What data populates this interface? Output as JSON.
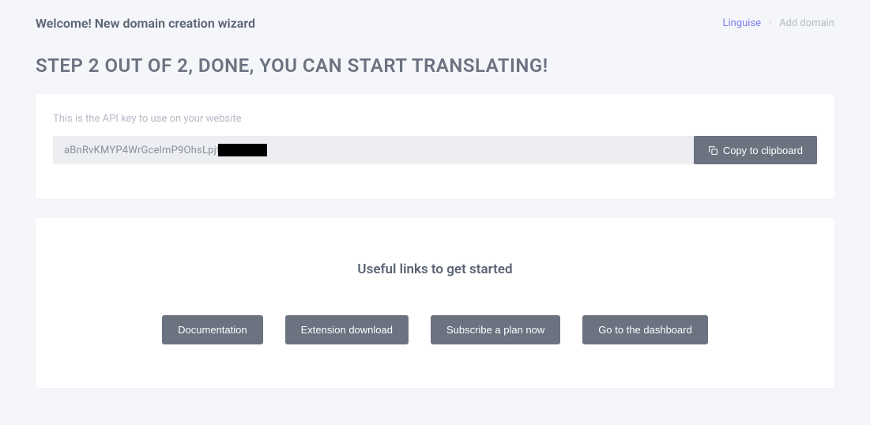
{
  "header": {
    "title": "Welcome! New domain creation wizard",
    "breadcrumb": {
      "link": "Linguise",
      "current": "Add domain"
    }
  },
  "step_heading": "STEP 2 OUT OF 2, DONE, YOU CAN START TRANSLATING!",
  "api": {
    "label": "This is the API key to use on your website",
    "key": "aBnRvKMYP4WrGcelmP9OhsLpjt",
    "copy_label": "Copy to clipboard"
  },
  "links": {
    "title": "Useful links to get started",
    "buttons": {
      "documentation": "Documentation",
      "extension": "Extension download",
      "subscribe": "Subscribe a plan now",
      "dashboard": "Go to the dashboard"
    }
  }
}
